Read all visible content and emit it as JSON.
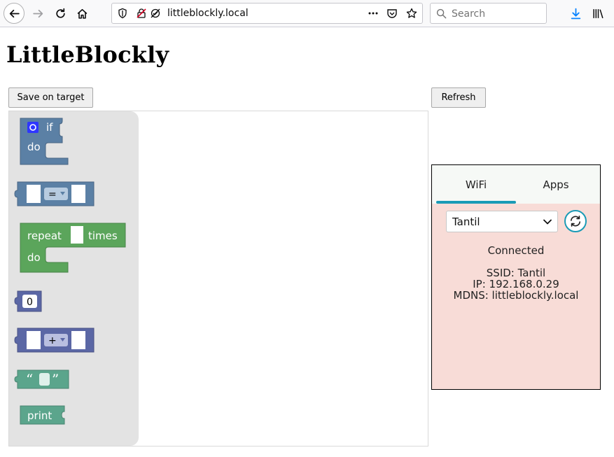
{
  "browser": {
    "url": "littleblockly.local",
    "search_placeholder": "Search"
  },
  "page": {
    "title": "LittleBlockly",
    "save_label": "Save on target",
    "refresh_label": "Refresh"
  },
  "blocks": {
    "if_label": "if",
    "do_label": "do",
    "compare_op": "=",
    "repeat_label": "repeat",
    "times_label": "times",
    "repeat_do_label": "do",
    "number_value": "0",
    "arith_op": "+",
    "open_quote": "“",
    "close_quote": "”",
    "print_label": "print",
    "colors": {
      "logic": "#5b80a5",
      "loop": "#5ba55b",
      "math": "#5b67a5",
      "text": "#5ba58c"
    }
  },
  "wifi_panel": {
    "tabs": [
      "WiFi",
      "Apps"
    ],
    "active_tab": "WiFi",
    "selected_network": "Tantil",
    "status": "Connected",
    "ssid": "SSID: Tantil",
    "ip": "IP: 192.168.0.29",
    "mdns": "MDNS: littleblockly.local",
    "accent": "#1a9bb6",
    "background": "#f8dcd7"
  }
}
